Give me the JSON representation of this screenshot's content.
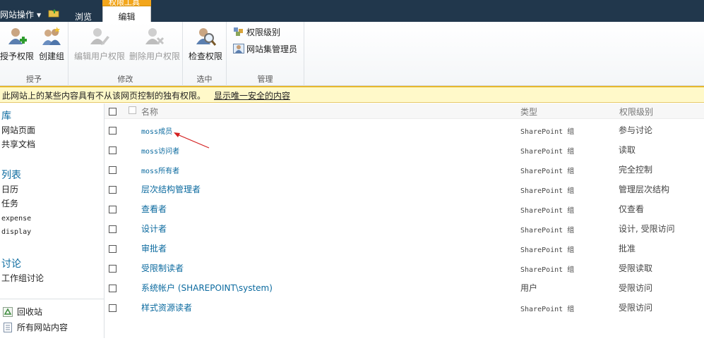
{
  "topbar": {
    "site_actions": "网站操作",
    "tab_browse": "浏览",
    "context_group": "权限工具",
    "tab_edit": "编辑"
  },
  "ribbon": {
    "groups": {
      "grant": {
        "label": "授予",
        "grant_permissions": "授予权限",
        "create_group": "创建组"
      },
      "modify": {
        "label": "修改",
        "edit_user_permissions": "编辑用户权限",
        "remove_user_permissions": "删除用户权限"
      },
      "check": {
        "label": "选中",
        "check_permissions": "检查权限"
      },
      "manage": {
        "label": "管理",
        "permission_levels": "权限级别",
        "site_collection_admins": "网站集管理员"
      }
    }
  },
  "notice": {
    "text": "此网站上的某些内容具有不从该网页控制的独有权限。",
    "link": "显示唯一安全的内容"
  },
  "leftnav": {
    "libraries": {
      "heading": "库",
      "items": [
        "网站页面",
        "共享文档"
      ]
    },
    "lists": {
      "heading": "列表",
      "items": [
        "日历",
        "任务",
        "expense",
        "display"
      ]
    },
    "discussions": {
      "heading": "讨论",
      "items": [
        "工作组讨论"
      ]
    },
    "footer": {
      "recycle_bin": "回收站",
      "all_content": "所有网站内容"
    }
  },
  "table": {
    "headers": {
      "name": "名称",
      "type": "类型",
      "permission": "权限级别"
    },
    "rows": [
      {
        "name": "moss成员",
        "type": "SharePoint 组",
        "permission": "参与讨论"
      },
      {
        "name": "moss访问者",
        "type": "SharePoint 组",
        "permission": "读取"
      },
      {
        "name": "moss所有者",
        "type": "SharePoint 组",
        "permission": "完全控制"
      },
      {
        "name": "层次结构管理者",
        "type": "SharePoint 组",
        "permission": "管理层次结构"
      },
      {
        "name": "查看者",
        "type": "SharePoint 组",
        "permission": "仅查看"
      },
      {
        "name": "设计者",
        "type": "SharePoint 组",
        "permission": "设计, 受限访问"
      },
      {
        "name": "审批者",
        "type": "SharePoint 组",
        "permission": "批准"
      },
      {
        "name": "受限制读者",
        "type": "SharePoint 组",
        "permission": "受限读取"
      },
      {
        "name": "系统帐户 (SHAREPOINT\\system)",
        "type": "用户",
        "permission": "受限访问"
      },
      {
        "name": "样式资源读者",
        "type": "SharePoint 组",
        "permission": "受限访问"
      }
    ]
  },
  "colors": {
    "topbar": "#21374c",
    "context_tab": "#f3a61b",
    "link": "#0b6a9f",
    "notice_bg": "#fff9c9",
    "annotation_arrow": "#d42020"
  },
  "icons": {
    "grant_permissions": "add-user-icon",
    "create_group": "group-icon",
    "edit_user_permissions": "edit-user-icon",
    "remove_user_permissions": "remove-user-icon",
    "check_permissions": "magnifier-user-icon",
    "permission_levels": "permission-levels-icon",
    "site_collection_admins": "admin-icon",
    "recycle_bin": "recycle-bin-icon",
    "all_content": "site-content-icon"
  }
}
